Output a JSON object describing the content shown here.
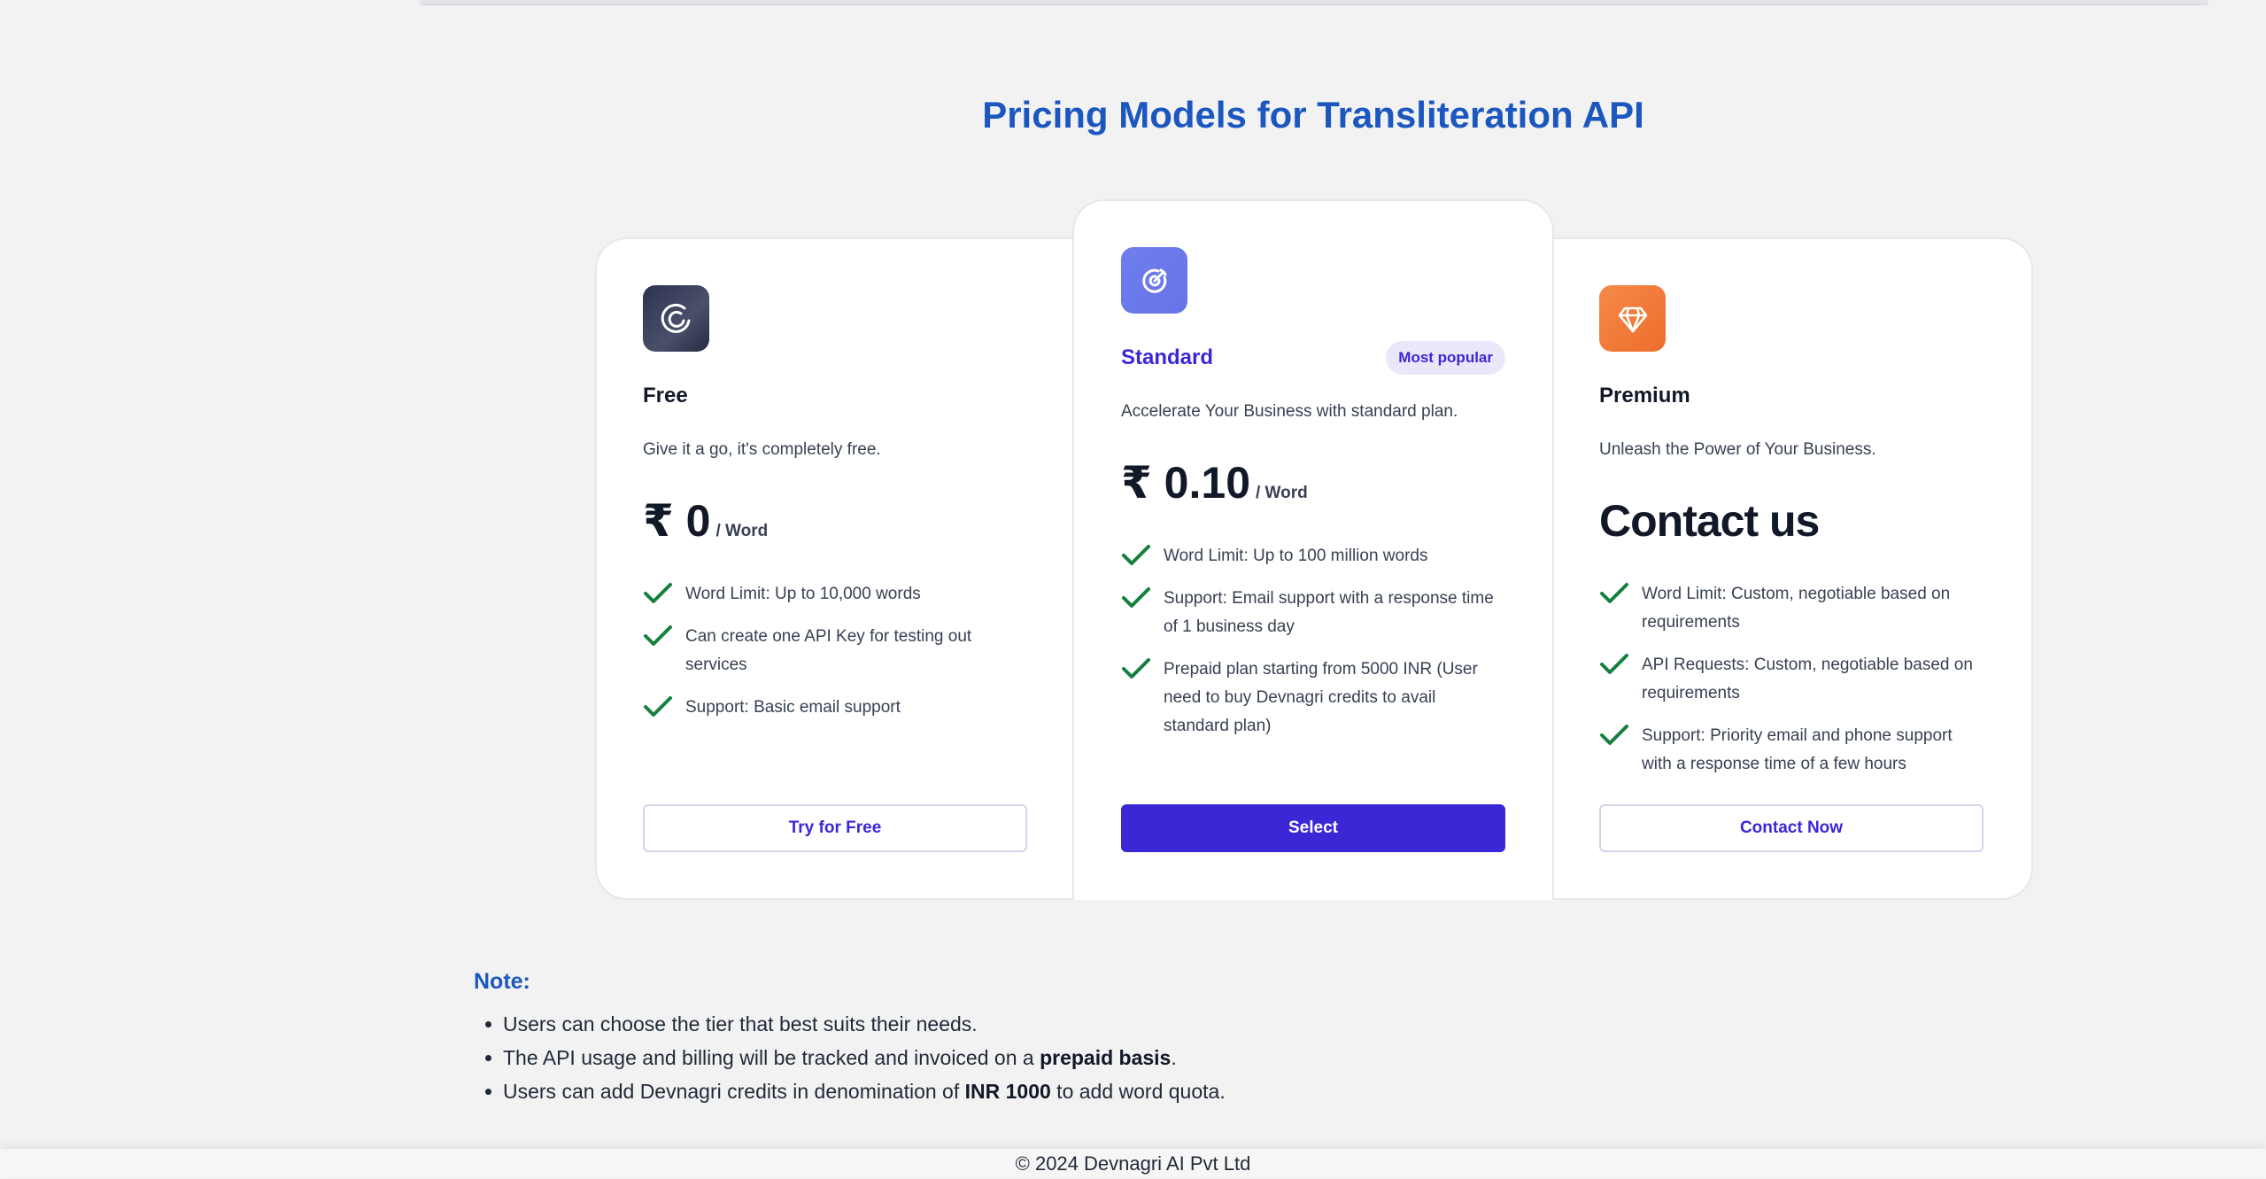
{
  "page": {
    "title": "Pricing Models for Transliteration API",
    "footer": "© 2024 Devnagri AI Pvt Ltd"
  },
  "colors": {
    "accent": "#3b27d6",
    "title_blue": "#1c57c0",
    "check_green": "#15803d"
  },
  "plans": [
    {
      "name": "Free",
      "icon": "spinner-circle-icon",
      "description": "Give it a go, it's completely free.",
      "price": "₹ 0",
      "per": "/ Word",
      "features": [
        "Word Limit: Up to 10,000 words",
        "Can create one API Key for testing out services",
        "Support: Basic email support"
      ],
      "button": "Try for Free"
    },
    {
      "name": "Standard",
      "icon": "target-icon",
      "badge": "Most popular",
      "description": "Accelerate Your Business with standard plan.",
      "price": "₹ 0.10",
      "per": "/ Word",
      "features": [
        "Word Limit: Up to 100 million words",
        "Support: Email support with a response time of 1 business day",
        "Prepaid plan starting from 5000 INR (User need to buy Devnagri credits to avail standard plan)"
      ],
      "button": "Select"
    },
    {
      "name": "Premium",
      "icon": "diamond-icon",
      "description": "Unleash the Power of Your Business.",
      "price": "Contact us",
      "features": [
        "Word Limit: Custom, negotiable based on requirements",
        "API Requests: Custom, negotiable based on requirements",
        "Support: Priority email and phone support with a response time of a few hours"
      ],
      "button": "Contact Now"
    }
  ],
  "note": {
    "title": "Note:",
    "items": [
      {
        "pre": "Users can choose the tier that best suits their needs.",
        "bold": "",
        "post": ""
      },
      {
        "pre": "The API usage and billing will be tracked and invoiced on a ",
        "bold": "prepaid basis",
        "post": "."
      },
      {
        "pre": "Users can add Devnagri credits in denomination of ",
        "bold": "INR 1000",
        "post": " to add word quota."
      }
    ]
  }
}
